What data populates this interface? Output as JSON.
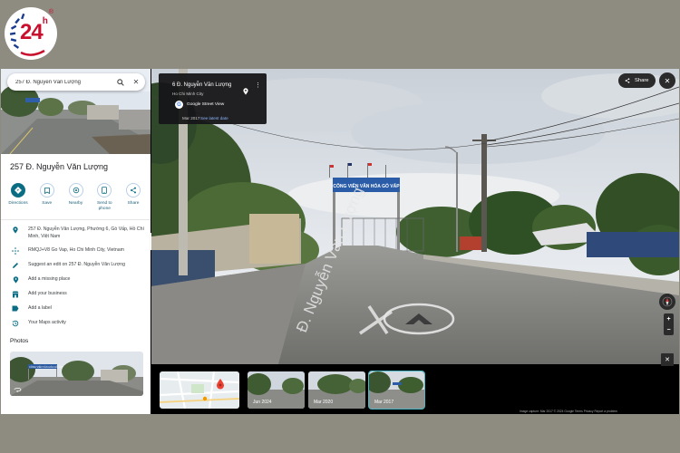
{
  "logo": {
    "text": "24",
    "sup": "h",
    "reg": "®"
  },
  "search": {
    "value": "257 Đ. Nguyễn Văn Lượng"
  },
  "panel": {
    "title": "257 Đ. Nguyễn Văn Lượng",
    "actions": [
      {
        "label": "Directions",
        "icon": "directions-icon"
      },
      {
        "label": "Save",
        "icon": "bookmark-icon"
      },
      {
        "label": "Nearby",
        "icon": "nearby-icon"
      },
      {
        "label": "Send to phone",
        "icon": "phone-icon"
      },
      {
        "label": "Share",
        "icon": "share-icon"
      }
    ],
    "rows": [
      {
        "text": "257 Đ. Nguyễn Văn Lượng, Phường 6, Gò Vấp, Hồ Chí Minh, Việt Nam",
        "icon": "pin-icon"
      },
      {
        "text": "RMQJ+V8 Go Vap, Ho Chi Minh City, Vietnam",
        "icon": "plus-code-icon"
      },
      {
        "text": "Suggest an edit on 257 Đ. Nguyễn Văn Lượng",
        "icon": "pencil-icon"
      },
      {
        "text": "Add a missing place",
        "icon": "add-place-icon"
      },
      {
        "text": "Add your business",
        "icon": "business-icon"
      },
      {
        "text": "Add a label",
        "icon": "label-icon"
      },
      {
        "text": "Your Maps activity",
        "icon": "history-icon"
      }
    ],
    "photos_heading": "Photos",
    "photo_sign": "CÔNG VIÊN VĂN HÓA GÒ VẤP"
  },
  "infocard": {
    "title": "6 Đ. Nguyễn Văn Lượng",
    "subtitle": "Ho Chi Minh City",
    "service": "Google Street View",
    "date": "Mar 2017",
    "latest": "See latest date"
  },
  "scene": {
    "gate_sign": "CÔNG VIÊN VĂN HÓA GÒ VẤP",
    "road_text": "Đ. Nguyễn Văn Lượng"
  },
  "controls": {
    "share": "Share"
  },
  "timeline": [
    {
      "label": "",
      "selected": false
    },
    {
      "label": "Jun 2024",
      "selected": false
    },
    {
      "label": "Mar 2020",
      "selected": false
    },
    {
      "label": "Mar 2017",
      "selected": true
    }
  ],
  "footer": "Image capture: Mar 2017  © 2024 Google   Terms   Privacy   Report a problem",
  "colors": {
    "accent": "#0b6d83",
    "link": "#8ab4f8",
    "selected_outline": "#4db6c5"
  }
}
